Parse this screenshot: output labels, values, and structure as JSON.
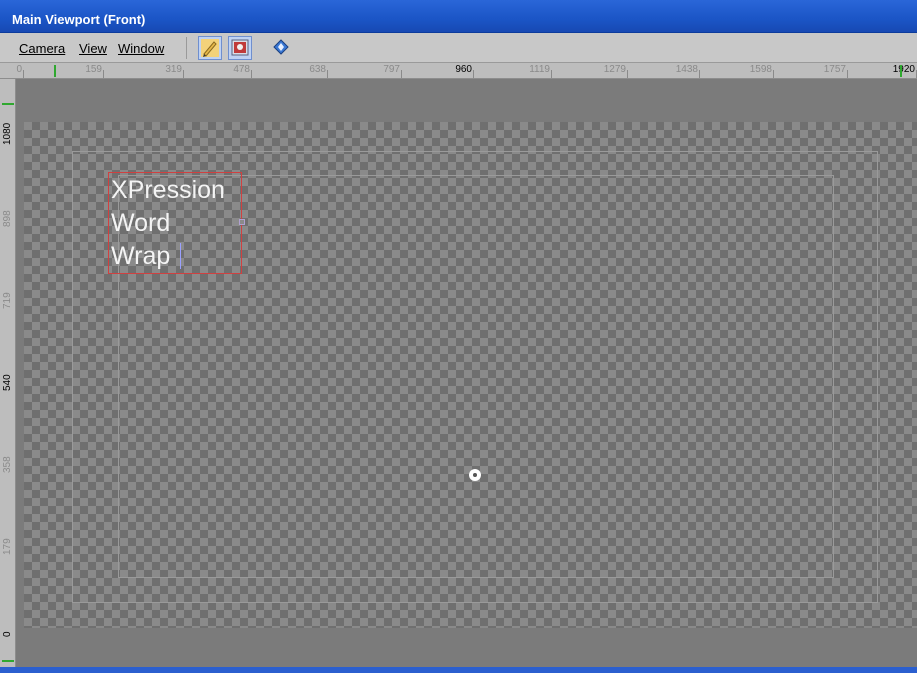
{
  "window": {
    "title": "Main Viewport (Front)"
  },
  "menu": {
    "camera": "Camera",
    "view": "View",
    "window": "Window"
  },
  "toolbar": [
    {
      "icon": "pencil-icon",
      "active": true
    },
    {
      "icon": "render-icon",
      "active": true
    },
    {
      "icon": "navigate-diamond-icon",
      "active": false
    }
  ],
  "ruler_h": [
    {
      "label": "0",
      "major": true
    },
    {
      "label": "159",
      "major": false
    },
    {
      "label": "319",
      "major": false
    },
    {
      "label": "478",
      "major": false
    },
    {
      "label": "638",
      "major": false
    },
    {
      "label": "797",
      "major": false
    },
    {
      "label": "960",
      "major": true
    },
    {
      "label": "1119",
      "major": false
    },
    {
      "label": "1279",
      "major": false
    },
    {
      "label": "1438",
      "major": false
    },
    {
      "label": "1598",
      "major": false
    },
    {
      "label": "1757",
      "major": false
    },
    {
      "label": "1920",
      "major": true
    }
  ],
  "ruler_v": [
    {
      "label": "1080",
      "major": true
    },
    {
      "label": "898",
      "major": false
    },
    {
      "label": "719",
      "major": false
    },
    {
      "label": "540",
      "major": true
    },
    {
      "label": "358",
      "major": false
    },
    {
      "label": "179",
      "major": false
    },
    {
      "label": "0",
      "major": true
    }
  ],
  "text_object": {
    "lines": [
      "XPression",
      "Word",
      "Wrap"
    ]
  },
  "colors": {
    "titlebar": "#1b55c6",
    "selection_border": "#d04040",
    "guide_marker": "#2fa82f"
  }
}
